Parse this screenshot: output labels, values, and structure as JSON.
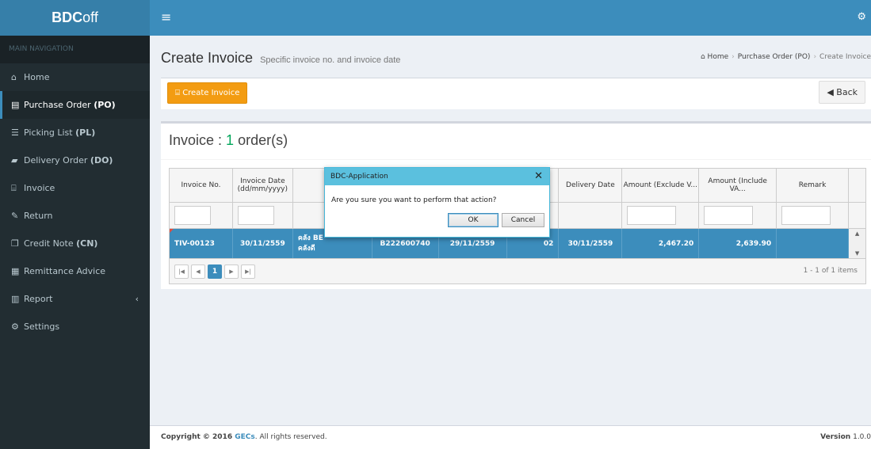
{
  "brand": {
    "strong": "BDC",
    "rest": "off"
  },
  "header": {
    "menu_icon": "hamburger-icon",
    "settings_icon": "gears-icon"
  },
  "sidebar": {
    "header": "MAIN NAVIGATION",
    "items": [
      {
        "icon": "home-icon",
        "label": "Home",
        "abbr": ""
      },
      {
        "icon": "file-icon",
        "label": "Purchase Order",
        "abbr": "(PO)"
      },
      {
        "icon": "list-icon",
        "label": "Picking List",
        "abbr": "(PL)"
      },
      {
        "icon": "truck-icon",
        "label": "Delivery Order",
        "abbr": "(DO)"
      },
      {
        "icon": "bank-icon",
        "label": "Invoice",
        "abbr": ""
      },
      {
        "icon": "edit-icon",
        "label": "Return",
        "abbr": ""
      },
      {
        "icon": "copy-icon",
        "label": "Credit Note",
        "abbr": "(CN)"
      },
      {
        "icon": "calendar-icon",
        "label": "Remittance Advice",
        "abbr": ""
      },
      {
        "icon": "bar-chart-icon",
        "label": "Report",
        "abbr": ""
      },
      {
        "icon": "gears-icon",
        "label": "Settings",
        "abbr": ""
      }
    ]
  },
  "page": {
    "title": "Create Invoice",
    "subtitle": "Specific invoice no. and invoice date"
  },
  "breadcrumb": {
    "home": "Home",
    "parent": "Purchase Order (PO)",
    "current": "Create Invoice"
  },
  "toolbar": {
    "create_label": "Create Invoice",
    "back_label": "Back"
  },
  "panel": {
    "title_prefix": "Invoice : ",
    "count": "1",
    "title_suffix": " order(s)"
  },
  "grid": {
    "columns": [
      "Invoice No.",
      "Invoice Date (dd/mm/yyyy)",
      "",
      "",
      "",
      "",
      "Delivery Date",
      "Amount (Exclude V...",
      "Amount (Include VA...",
      "Remark"
    ],
    "row": {
      "invoice_no": "TIV-00123",
      "invoice_date": "30/11/2559",
      "store": "คลัง BE\nคลังดี",
      "po_no": "B222600740",
      "po_date": "29/11/2559",
      "qty": "02",
      "delivery_date": "30/11/2559",
      "amount_ex": "2,467.20",
      "amount_inc": "2,639.90",
      "remark": ""
    }
  },
  "pager": {
    "first": "|◀",
    "prev": "◀",
    "page": "1",
    "next": "▶",
    "last": "▶|",
    "info": "1 - 1 of 1 items"
  },
  "dialog": {
    "title": "BDC-Application",
    "message": "Are you sure you want to perform that action?",
    "ok": "OK",
    "cancel": "Cancel",
    "close": "✕"
  },
  "footer": {
    "copyright": "Copyright © 2016 ",
    "company": "GECs",
    "rights": ". All rights reserved.",
    "version_label": "Version",
    "version": "1.0.0"
  }
}
